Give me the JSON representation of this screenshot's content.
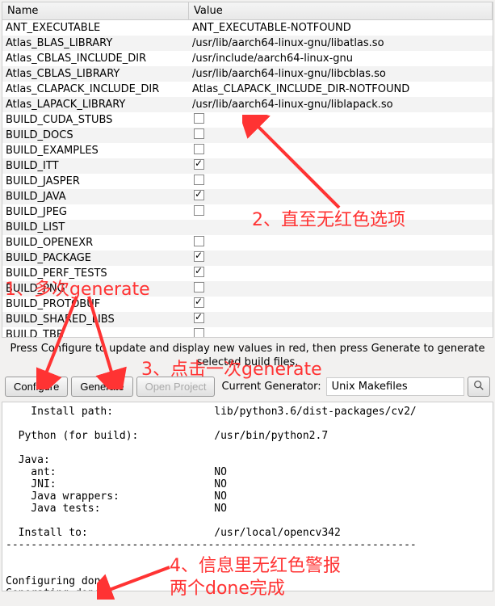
{
  "table": {
    "headers": {
      "name": "Name",
      "value": "Value"
    },
    "rows": [
      {
        "name": "ANT_EXECUTABLE",
        "value": "ANT_EXECUTABLE-NOTFOUND",
        "type": "text"
      },
      {
        "name": "Atlas_BLAS_LIBRARY",
        "value": "/usr/lib/aarch64-linux-gnu/libatlas.so",
        "type": "text"
      },
      {
        "name": "Atlas_CBLAS_INCLUDE_DIR",
        "value": "/usr/include/aarch64-linux-gnu",
        "type": "text"
      },
      {
        "name": "Atlas_CBLAS_LIBRARY",
        "value": "/usr/lib/aarch64-linux-gnu/libcblas.so",
        "type": "text"
      },
      {
        "name": "Atlas_CLAPACK_INCLUDE_DIR",
        "value": "Atlas_CLAPACK_INCLUDE_DIR-NOTFOUND",
        "type": "text"
      },
      {
        "name": "Atlas_LAPACK_LIBRARY",
        "value": "/usr/lib/aarch64-linux-gnu/liblapack.so",
        "type": "text"
      },
      {
        "name": "BUILD_CUDA_STUBS",
        "value": false,
        "type": "bool"
      },
      {
        "name": "BUILD_DOCS",
        "value": false,
        "type": "bool"
      },
      {
        "name": "BUILD_EXAMPLES",
        "value": false,
        "type": "bool"
      },
      {
        "name": "BUILD_ITT",
        "value": true,
        "type": "bool"
      },
      {
        "name": "BUILD_JASPER",
        "value": false,
        "type": "bool"
      },
      {
        "name": "BUILD_JAVA",
        "value": true,
        "type": "bool"
      },
      {
        "name": "BUILD_JPEG",
        "value": false,
        "type": "bool"
      },
      {
        "name": "BUILD_LIST",
        "value": "",
        "type": "text"
      },
      {
        "name": "BUILD_OPENEXR",
        "value": false,
        "type": "bool"
      },
      {
        "name": "BUILD_PACKAGE",
        "value": true,
        "type": "bool"
      },
      {
        "name": "BUILD_PERF_TESTS",
        "value": true,
        "type": "bool"
      },
      {
        "name": "BUILD_PNG",
        "value": false,
        "type": "bool"
      },
      {
        "name": "BUILD_PROTOBUF",
        "value": true,
        "type": "bool"
      },
      {
        "name": "BUILD_SHARED_LIBS",
        "value": true,
        "type": "bool"
      },
      {
        "name": "BUILD_TBB",
        "value": false,
        "type": "bool"
      }
    ]
  },
  "instruction": "Press Configure to update and display new values in red, then press Generate to generate selected build files.",
  "buttons": {
    "configure": "Configure",
    "generate": "Generate",
    "open_project": "Open Project"
  },
  "generator": {
    "label": "Current Generator:",
    "value": "Unix Makefiles"
  },
  "output": "    Install path:                lib/python3.6/dist-packages/cv2/\n\n  Python (for build):            /usr/bin/python2.7\n\n  Java:\n    ant:                         NO\n    JNI:                         NO\n    Java wrappers:               NO\n    Java tests:                  NO\n\n  Install to:                    /usr/local/opencv342\n-----------------------------------------------------------------\n\n\nConfiguring done\nGenerating done",
  "annotations": {
    "a1": "1、多次generate",
    "a2": "2、直至无红色选项",
    "a3": "3、点击一次generate",
    "a4_line1": "4、信息里无红色警报",
    "a4_line2": "两个done完成"
  }
}
